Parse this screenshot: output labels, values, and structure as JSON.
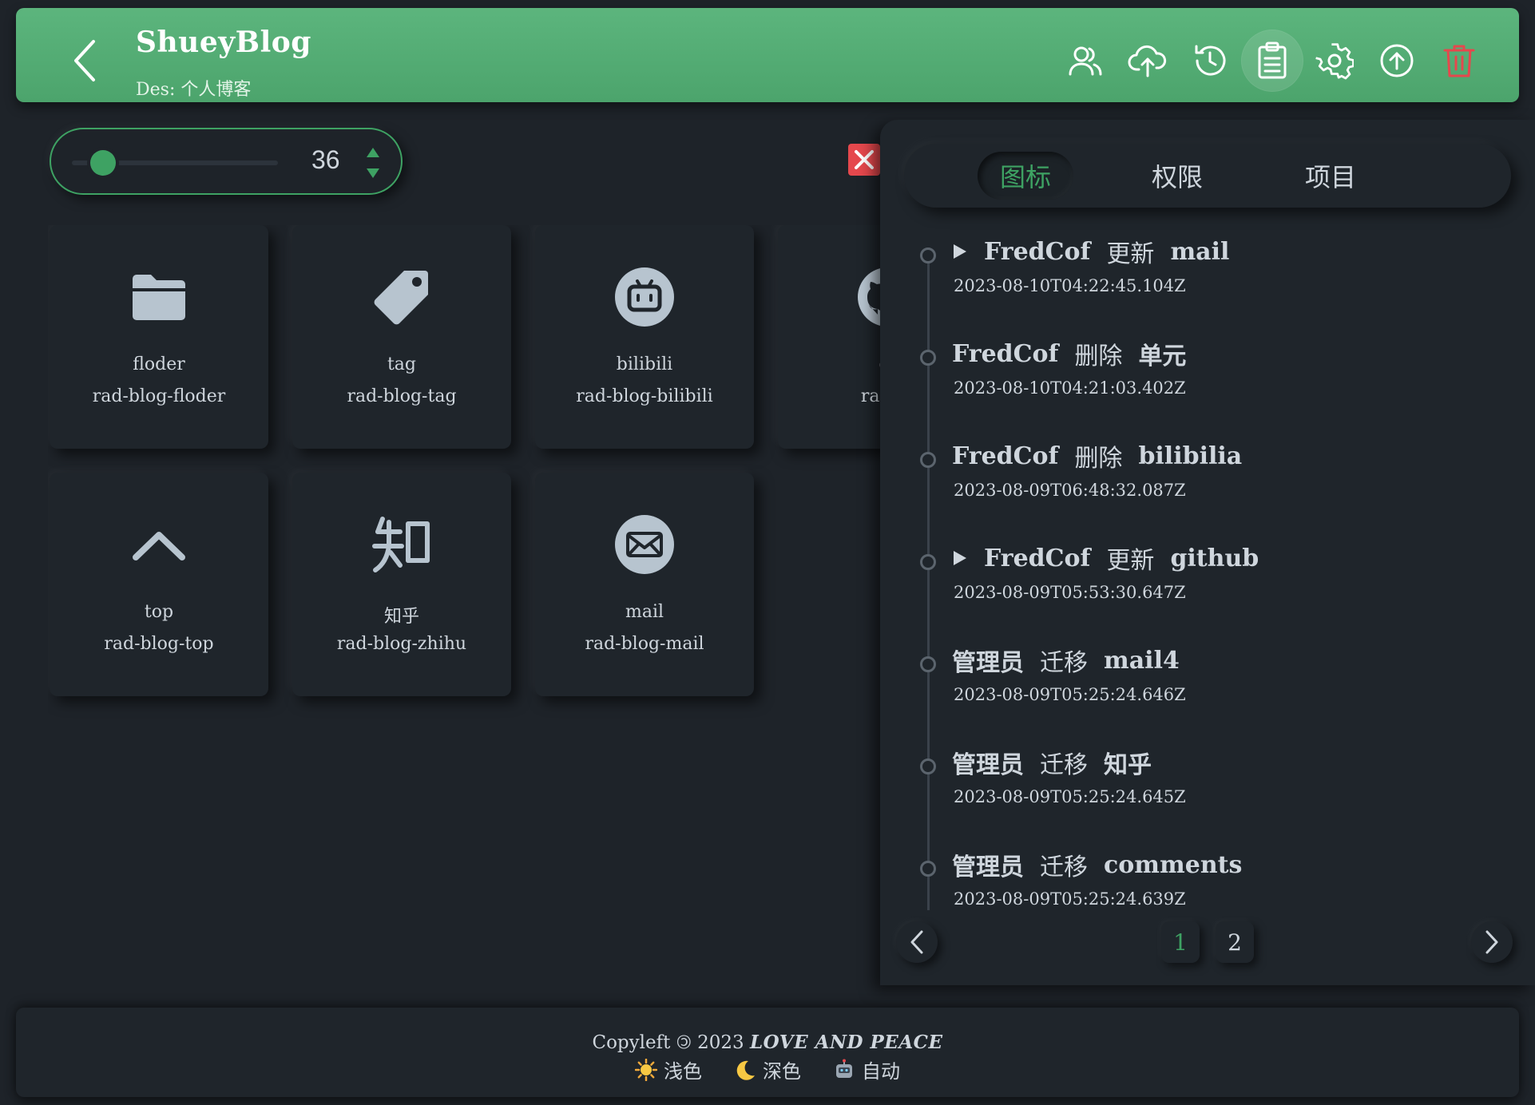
{
  "header": {
    "title": "ShueyBlog",
    "desc": "Des: 个人博客"
  },
  "toolbar": {
    "icons": [
      "users-icon",
      "cloud-upload-icon",
      "history-icon",
      "clipboard-icon",
      "gear-icon",
      "upload-circle-icon",
      "trash-icon"
    ],
    "active": "clipboard-icon"
  },
  "size_control": {
    "value": "36",
    "slider_fraction": 0.15
  },
  "icon_cards": [
    {
      "name": "floder",
      "code": "rad-blog-floder",
      "icon": "folder-icon"
    },
    {
      "name": "tag",
      "code": "rad-blog-tag",
      "icon": "tag-icon"
    },
    {
      "name": "bilibili",
      "code": "rad-blog-bilibili",
      "icon": "bilibili-icon"
    },
    {
      "name": "gi",
      "code": "rad-bl",
      "icon": "github-icon"
    },
    {
      "name": "top",
      "code": "rad-blog-top",
      "icon": "chevron-up-icon"
    },
    {
      "name": "知乎",
      "code": "rad-blog-zhihu",
      "icon": "zhihu-icon"
    },
    {
      "name": "mail",
      "code": "rad-blog-mail",
      "icon": "mail-icon"
    }
  ],
  "panel": {
    "tabs": [
      "图标",
      "权限",
      "项目"
    ],
    "active_tab": "图标",
    "log": [
      {
        "expandable": true,
        "user": "FredCof",
        "action": "更新",
        "target": "mail",
        "time": "2023-08-10T04:22:45.104Z"
      },
      {
        "expandable": false,
        "user": "FredCof",
        "action": "删除",
        "target": "单元",
        "time": "2023-08-10T04:21:03.402Z"
      },
      {
        "expandable": false,
        "user": "FredCof",
        "action": "删除",
        "target": "bilibilia",
        "time": "2023-08-09T06:48:32.087Z"
      },
      {
        "expandable": true,
        "user": "FredCof",
        "action": "更新",
        "target": "github",
        "time": "2023-08-09T05:53:30.647Z"
      },
      {
        "expandable": false,
        "user": "管理员",
        "action": "迁移",
        "target": "mail4",
        "time": "2023-08-09T05:25:24.646Z"
      },
      {
        "expandable": false,
        "user": "管理员",
        "action": "迁移",
        "target": "知乎",
        "time": "2023-08-09T05:25:24.645Z"
      },
      {
        "expandable": false,
        "user": "管理员",
        "action": "迁移",
        "target": "comments",
        "time": "2023-08-09T05:25:24.639Z"
      }
    ],
    "pagination": {
      "pages": [
        "1",
        "2"
      ],
      "current": "1"
    }
  },
  "footer": {
    "copyright_prefix": "Copyleft ",
    "copyright_symbol": "🄯",
    "copyright_year": " 2023 ",
    "slogan": "LOVE AND PEACE",
    "themes": [
      {
        "icon": "sun-icon",
        "label": "浅色"
      },
      {
        "icon": "moon-icon",
        "label": "深色"
      },
      {
        "icon": "robot-icon",
        "label": "自动"
      }
    ]
  },
  "colors": {
    "accent": "#3ea263",
    "header_bg": "#55ad75",
    "page_bg": "#1e2329",
    "danger": "#e5484d"
  }
}
